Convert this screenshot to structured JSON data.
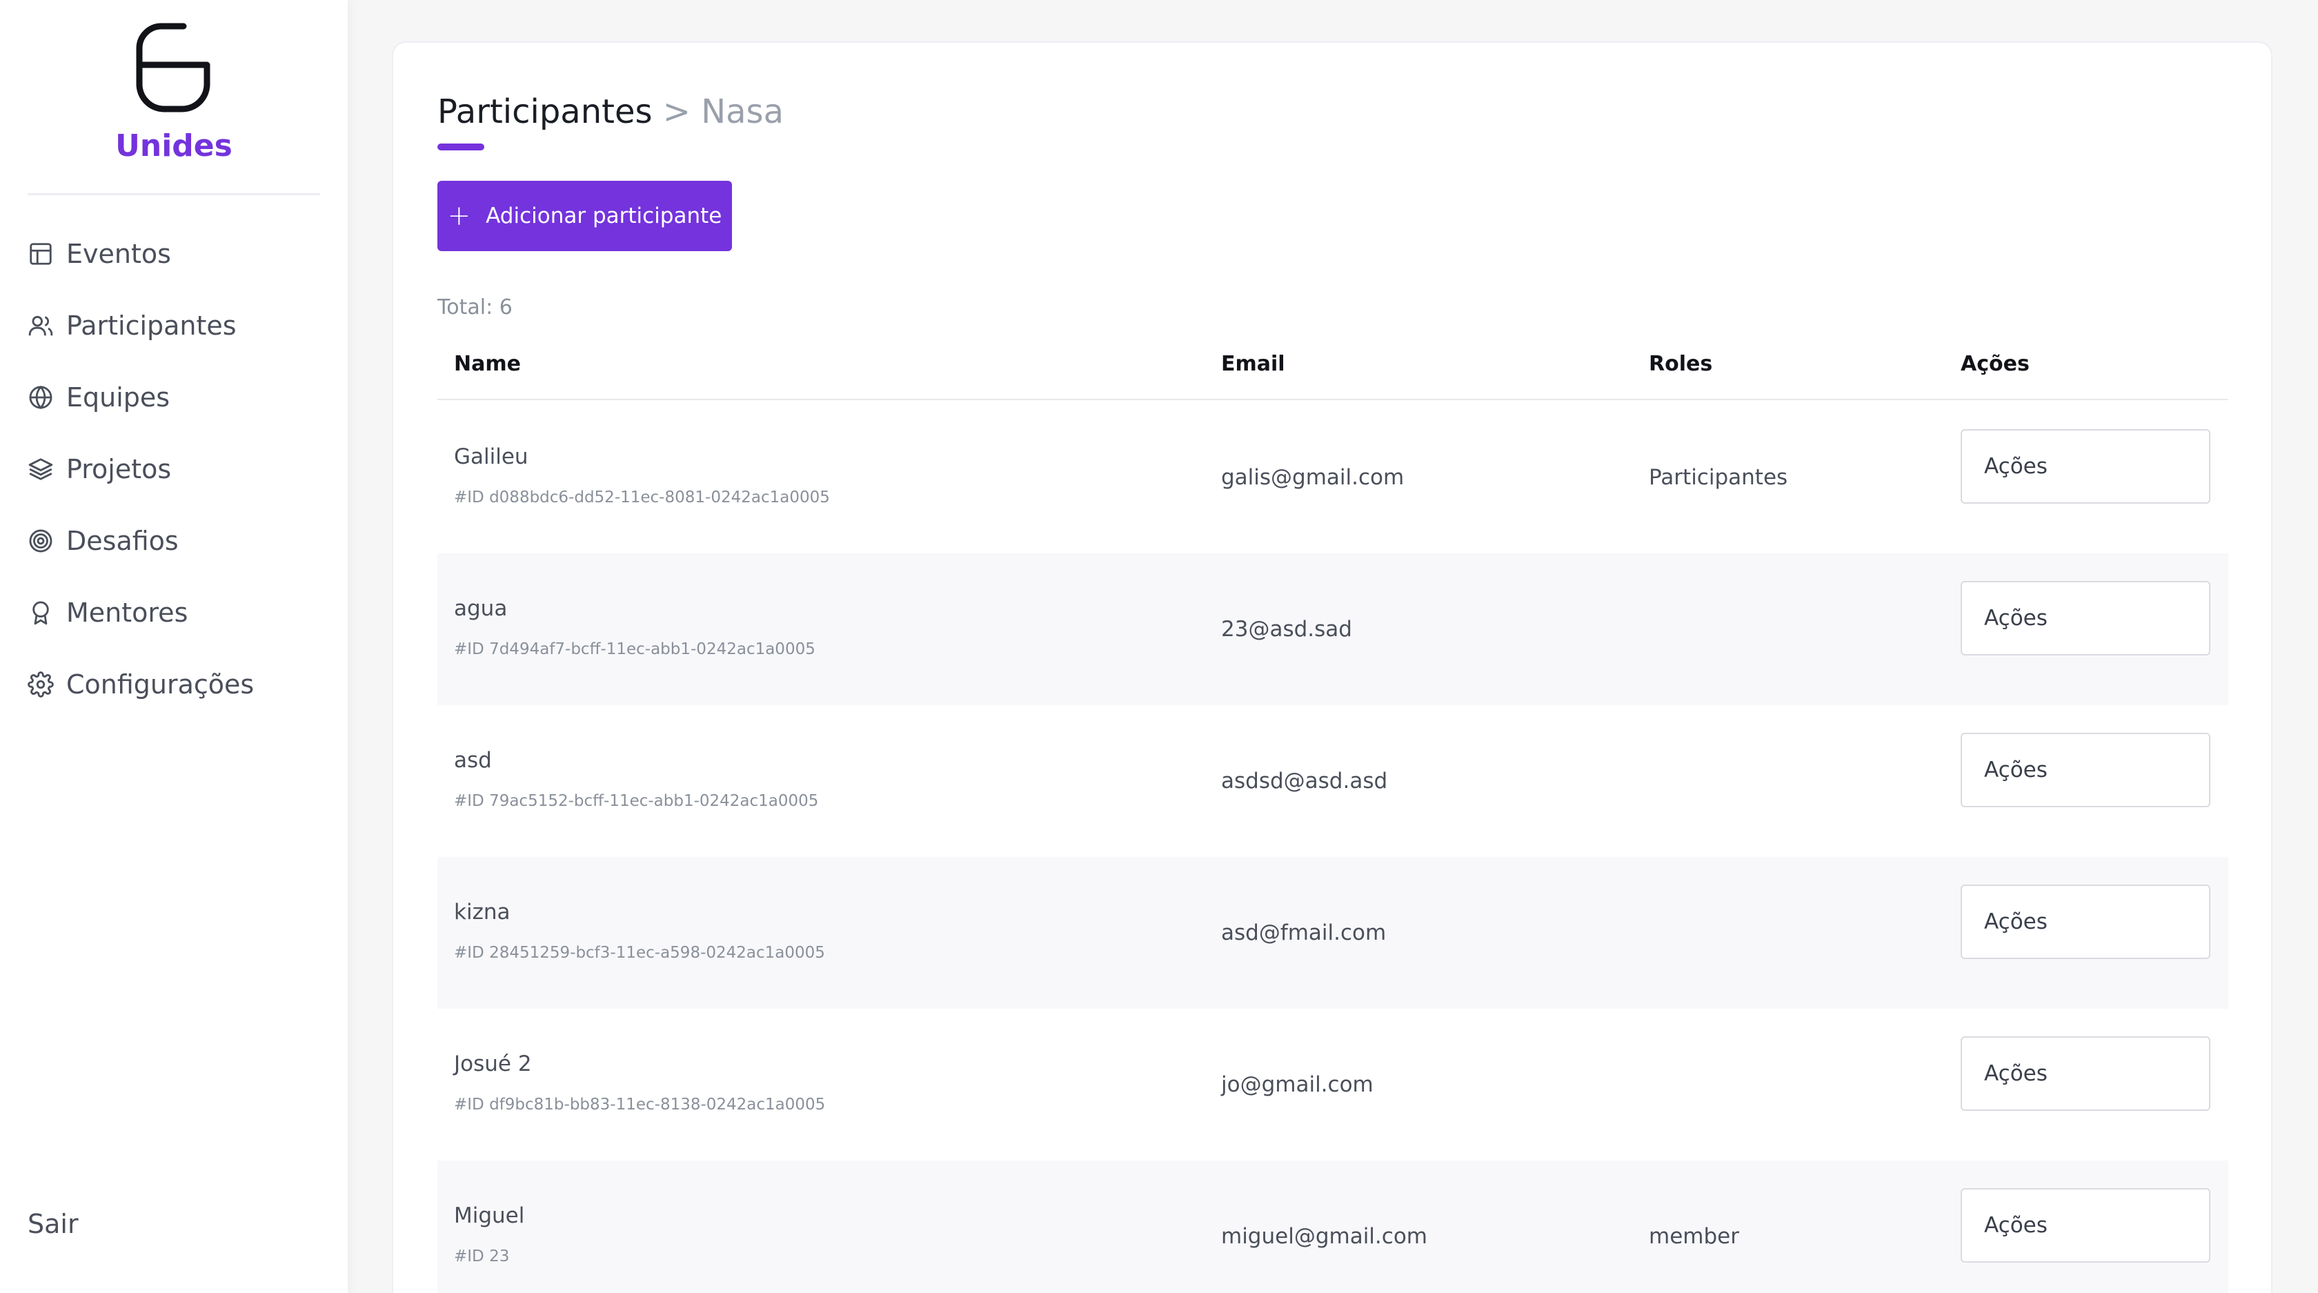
{
  "sidebar": {
    "brand": "Unides",
    "logo_icon": "unides-logo",
    "items": [
      {
        "label": "Eventos",
        "icon": "layout-icon"
      },
      {
        "label": "Participantes",
        "icon": "users-icon"
      },
      {
        "label": "Equipes",
        "icon": "globe-icon"
      },
      {
        "label": "Projetos",
        "icon": "layers-icon"
      },
      {
        "label": "Desafios",
        "icon": "target-icon"
      },
      {
        "label": "Mentores",
        "icon": "award-icon"
      },
      {
        "label": "Configurações",
        "icon": "gear-icon"
      }
    ],
    "signout": "Sair"
  },
  "header": {
    "title": "Participantes",
    "separator": ">",
    "subtitle": "Nasa"
  },
  "add_button": {
    "plus": "+",
    "label": "Adicionar participante"
  },
  "total": "Total: 6",
  "table": {
    "columns": [
      "Name",
      "Email",
      "Roles",
      "Ações"
    ],
    "rows": [
      {
        "name": "Galileu",
        "id": "#ID d088bdc6-dd52-11ec-8081-0242ac1a0005",
        "email": "galis@gmail.com",
        "role": "Participantes",
        "action": "Ações"
      },
      {
        "name": "agua",
        "id": "#ID 7d494af7-bcff-11ec-abb1-0242ac1a0005",
        "email": "23@asd.sad",
        "role": "",
        "action": "Ações"
      },
      {
        "name": "asd",
        "id": "#ID 79ac5152-bcff-11ec-abb1-0242ac1a0005",
        "email": "asdsd@asd.asd",
        "role": "",
        "action": "Ações"
      },
      {
        "name": "kizna",
        "id": "#ID 28451259-bcf3-11ec-a598-0242ac1a0005",
        "email": "asd@fmail.com",
        "role": "",
        "action": "Ações"
      },
      {
        "name": "Josué 2",
        "id": "#ID df9bc81b-bb83-11ec-8138-0242ac1a0005",
        "email": "jo@gmail.com",
        "role": "",
        "action": "Ações"
      },
      {
        "name": "Miguel",
        "id": "#ID 23",
        "email": "miguel@gmail.com",
        "role": "member",
        "action": "Ações"
      }
    ]
  },
  "colors": {
    "accent": "#7433dc",
    "row_alt": "#f8f8fb",
    "background": "#f6f6f7"
  }
}
